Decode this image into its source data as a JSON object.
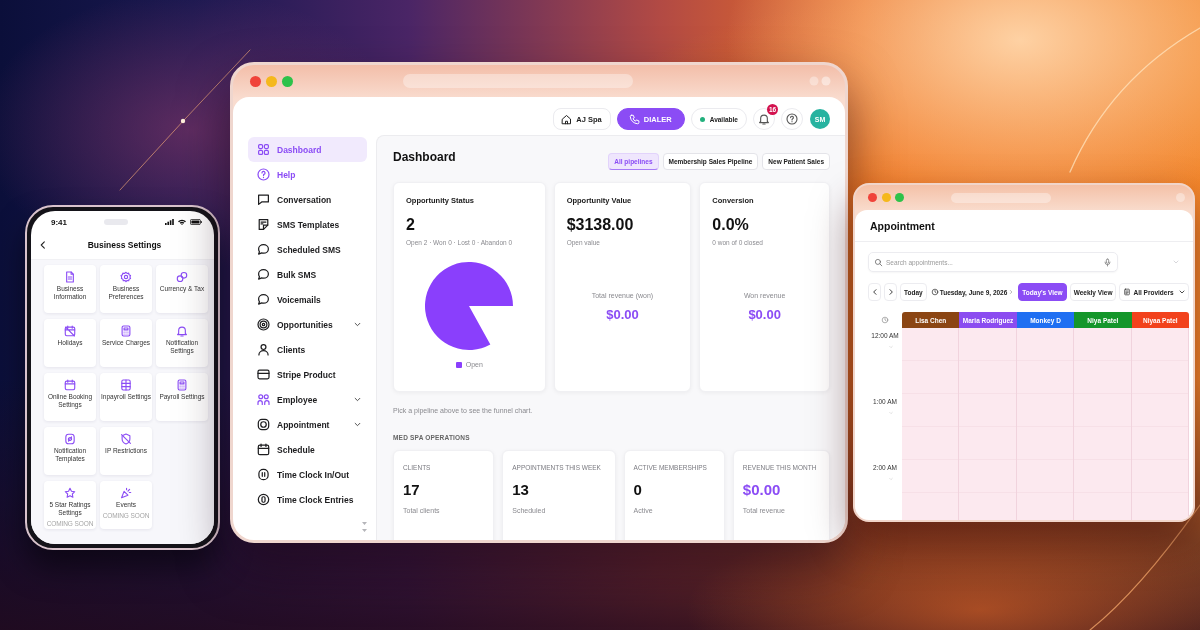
{
  "phone": {
    "status_bar": {
      "time": "9:41"
    },
    "title": "Business Settings",
    "sections": [
      {
        "tiles": [
          {
            "label": "Business Information"
          },
          {
            "label": "Business Preferences"
          },
          {
            "label": "Currency & Tax"
          },
          {
            "label": "Holidays"
          },
          {
            "label": "Service Charges"
          },
          {
            "label": "Notification Settings"
          },
          {
            "label": "Online Booking Settings"
          },
          {
            "label": "Inpayroll Settings"
          },
          {
            "label": "Payroll Settings"
          },
          {
            "label": "Notification Templates"
          },
          {
            "label": "IP Restrictions"
          }
        ]
      },
      {
        "tiles": [
          {
            "label": "5 Star Ratings Settings",
            "badge": "COMING SOON"
          },
          {
            "label": "Events",
            "badge": "COMING SOON"
          }
        ]
      }
    ]
  },
  "dashboard_window": {
    "header": {
      "business_button": "AJ Spa",
      "dialer_button": "DIALER",
      "availability": "Available",
      "notification_count": "16",
      "avatar_initials": "SM"
    },
    "sidebar": {
      "items": [
        {
          "label": "Dashboard",
          "kind": "page",
          "selected": true
        },
        {
          "label": "Help",
          "kind": "link",
          "selected": false
        },
        {
          "label": "Conversation",
          "kind": "page",
          "selected": false
        },
        {
          "label": "SMS Templates",
          "kind": "page",
          "selected": false
        },
        {
          "label": "Scheduled SMS",
          "kind": "page",
          "selected": false
        },
        {
          "label": "Bulk SMS",
          "kind": "page",
          "selected": false
        },
        {
          "label": "Voicemails",
          "kind": "page",
          "selected": false
        },
        {
          "label": "Opportunities",
          "kind": "group",
          "selected": false,
          "expanded": false
        },
        {
          "label": "Clients",
          "kind": "page",
          "selected": false
        },
        {
          "label": "Stripe Product",
          "kind": "page",
          "selected": false
        },
        {
          "label": "Employee",
          "kind": "group",
          "selected": false,
          "expanded": false
        },
        {
          "label": "Appointment",
          "kind": "group",
          "selected": false,
          "expanded": false
        },
        {
          "label": "Schedule",
          "kind": "page",
          "selected": false
        },
        {
          "label": "Time Clock In/Out",
          "kind": "page",
          "selected": false
        },
        {
          "label": "Time Clock Entries",
          "kind": "page",
          "selected": false
        }
      ]
    },
    "title": "Dashboard",
    "pipeline_filters": [
      {
        "label": "All pipelines",
        "selected": true
      },
      {
        "label": "Membership Sales Pipeline",
        "selected": false
      },
      {
        "label": "New Patient Sales",
        "selected": false
      }
    ],
    "cards": [
      {
        "kind": "chart",
        "title": "Opportunity Status",
        "value": "2",
        "caption": "Open 2 · Won 0 · Lost 0 · Abandon 0",
        "legend": "Open"
      },
      {
        "kind": "revenue",
        "title": "Opportunity Value",
        "value": "$3138.00",
        "caption": "Open value",
        "footer_label": "Total revenue (won)",
        "footer_value": "$0.00"
      },
      {
        "kind": "revenue",
        "title": "Conversion",
        "value": "0.0%",
        "caption": "0 won of 0 closed",
        "footer_label": "Won revenue",
        "footer_value": "$0.00"
      }
    ],
    "hint": "Pick a pipeline above to see the funnel chart.",
    "operations": {
      "title": "MED SPA OPERATIONS",
      "stats": [
        {
          "kind": "count",
          "label": "CLIENTS",
          "value": "17",
          "caption": "Total clients"
        },
        {
          "kind": "count",
          "label": "APPOINTMENTS THIS WEEK",
          "value": "13",
          "caption": "Scheduled"
        },
        {
          "kind": "count",
          "label": "ACTIVE MEMBERSHIPS",
          "value": "0",
          "caption": "Active"
        },
        {
          "kind": "currency",
          "label": "REVENUE THIS MONTH",
          "value": "$0.00",
          "caption": "Total revenue"
        }
      ]
    }
  },
  "appointment_window": {
    "title": "Appointment",
    "search": {
      "placeholder": "Search appointments..."
    },
    "toolbar": {
      "today_button": "Today",
      "date": "Tuesday, June 9, 2026",
      "views": [
        {
          "label": "Today's View",
          "selected": true
        },
        {
          "label": "Weekly View",
          "selected": false
        }
      ],
      "provider_filter": "All Providers"
    },
    "providers": [
      {
        "name": "Lisa Chen",
        "color": "#8b4513"
      },
      {
        "name": "Maria Rodriguez",
        "color": "#8b4cf0"
      },
      {
        "name": "Monkey D",
        "color": "#1f6ff2"
      },
      {
        "name": "Niya Patel",
        "color": "#14962a"
      },
      {
        "name": "Niyaa Patel",
        "color": "#f2421c"
      }
    ],
    "time_slots": [
      "12:00 AM",
      "1:00 AM",
      "2:00 AM"
    ]
  }
}
